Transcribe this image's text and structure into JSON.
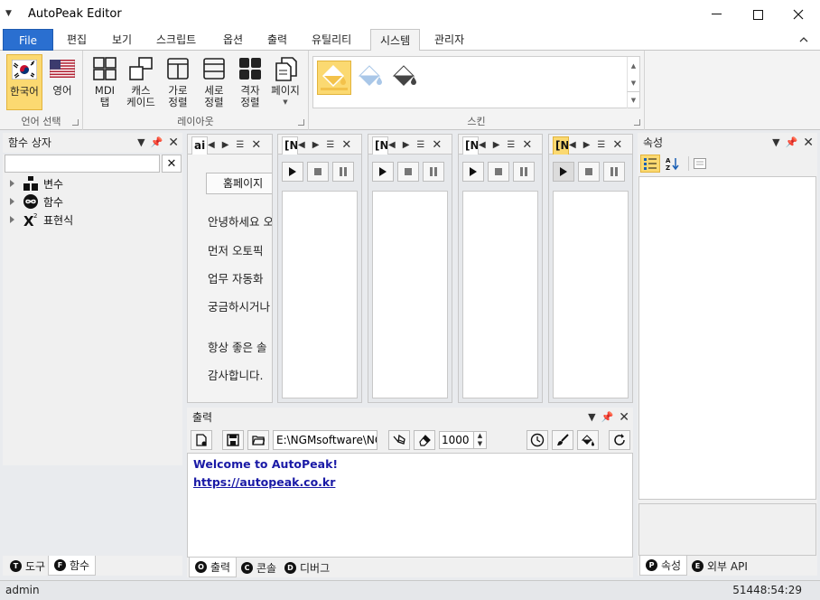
{
  "app": {
    "title": "AutoPeak Editor"
  },
  "ribbon": {
    "tabs": [
      {
        "label": "File"
      },
      {
        "label": "편집"
      },
      {
        "label": "보기"
      },
      {
        "label": "스크립트"
      },
      {
        "label": "옵션"
      },
      {
        "label": "출력"
      },
      {
        "label": "유틸리티"
      },
      {
        "label": "시스템"
      },
      {
        "label": "관리자"
      }
    ],
    "active_tab": "시스템",
    "groups": {
      "language": {
        "label": "언어 선택",
        "korean": "한국어",
        "english": "영어"
      },
      "layout": {
        "label": "레이아웃",
        "mdi_tab": "MDI\n탭",
        "cascade": "캐스\n케이드",
        "tile_h": "가로\n정렬",
        "tile_v": "세로\n정렬",
        "grid": "격자\n정렬",
        "page": "페이지"
      },
      "skin": {
        "label": "스킨"
      }
    }
  },
  "function_box": {
    "title": "함수 상자",
    "search_value": "",
    "tree": [
      {
        "label": "변수",
        "icon": "variable-icon"
      },
      {
        "label": "함수",
        "icon": "infinity-icon"
      },
      {
        "label": "표현식",
        "icon": "superscript-x-icon"
      }
    ],
    "tabs": [
      {
        "badge": "T",
        "label": "도구"
      },
      {
        "badge": "F",
        "label": "함수"
      }
    ]
  },
  "documents": {
    "home": {
      "tab_title": "ai",
      "button": "홈페이지",
      "lines": [
        "안녕하세요 오",
        "먼저 오토픽",
        "업무 자동화",
        "궁금하시거나",
        "항상 좋은 솔",
        "감사합니다."
      ]
    },
    "macro_tabs": [
      {
        "title": "[N"
      },
      {
        "title": "[N"
      },
      {
        "title": "[N"
      },
      {
        "title": "[N"
      }
    ]
  },
  "output": {
    "title": "출력",
    "path_value": "E:\\NGMsoftware\\NG",
    "count_value": "1000",
    "lines": [
      "Welcome to AutoPeak!",
      "https://autopeak.co.kr"
    ],
    "tabs": [
      {
        "badge": "O",
        "label": "출력"
      },
      {
        "badge": "C",
        "label": "콘솔"
      },
      {
        "badge": "D",
        "label": "디버그"
      }
    ]
  },
  "properties": {
    "title": "속성",
    "tabs": [
      {
        "badge": "P",
        "label": "속성"
      },
      {
        "badge": "E",
        "label": "외부 API"
      }
    ]
  },
  "status": {
    "user": "admin",
    "clock": "51448:54:29"
  },
  "colors": {
    "file_tab": "#2a6fd0",
    "selected": "#fbd971",
    "link": "#1a1aa6"
  }
}
